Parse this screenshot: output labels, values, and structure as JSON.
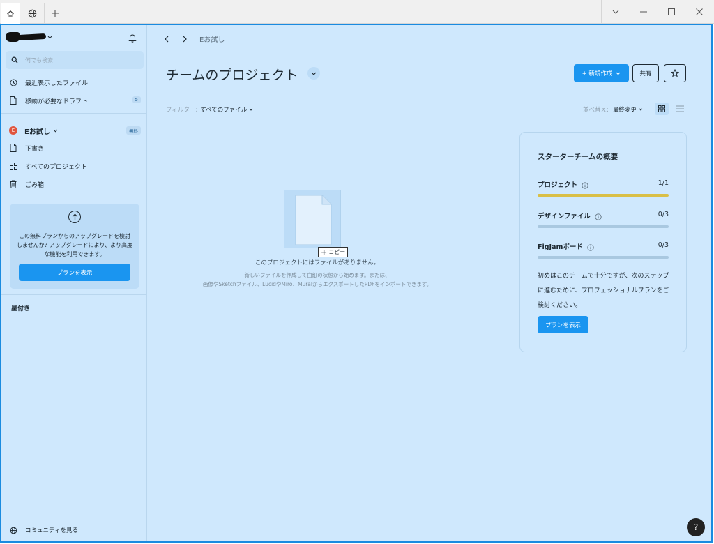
{
  "window": {
    "tabs": [
      {
        "icon": "home-icon"
      },
      {
        "icon": "globe-icon"
      }
    ],
    "new_tab_icon": "plus-icon",
    "controls": [
      "chevron-down-icon",
      "minimize-icon",
      "maximize-icon",
      "close-icon"
    ]
  },
  "sidebar": {
    "search_placeholder": "何でも検索",
    "items": [
      {
        "label": "最近表示したファイル",
        "icon": "clock-icon"
      },
      {
        "label": "移動が必要なドラフト",
        "icon": "file-icon",
        "badge": "5"
      }
    ],
    "team": {
      "initial": "E",
      "name": "Eお試し",
      "badge": "無料"
    },
    "team_items": [
      {
        "label": "下書き",
        "icon": "file-icon"
      },
      {
        "label": "すべてのプロジェクト",
        "icon": "grid-icon"
      },
      {
        "label": "ごみ箱",
        "icon": "trash-icon"
      }
    ],
    "upgrade": {
      "text": "この無料プランからのアップグレードを検討しませんか? アップグレードにより、より高度な機能を利用できます。",
      "button": "プランを表示"
    },
    "starred_heading": "星付き",
    "community": "コミュニティを見る"
  },
  "main": {
    "breadcrumb": "Eお試し",
    "title": "チームのプロジェクト",
    "new_button": "+ 新規作成",
    "share_button": "共有",
    "filter_label": "フィルター:",
    "filter_value": "すべてのファイル",
    "sort_label": "並べ替え:",
    "sort_value": "最終変更",
    "copy_tag": "コピー",
    "empty_title": "このプロジェクトにはファイルがありません。",
    "empty_line1": "新しいファイルを作成して白紙の状態から始めます。または、",
    "empty_line2": "画像やSketchファイル、LucidやMiro、MuralからエクスポートしたPDFをインポートできます。"
  },
  "overview": {
    "title": "スターターチームの概要",
    "rows": [
      {
        "label": "プロジェクト",
        "value": "1/1",
        "progress": 1.0
      },
      {
        "label": "デザインファイル",
        "value": "0/3",
        "progress": 0.0
      },
      {
        "label": "FigJamボード",
        "value": "0/3",
        "progress": 0.0
      }
    ],
    "description": "初めはこのチームで十分ですが、次のステップに進むために、プロフェッショナルプランをご検討ください。",
    "button": "プランを表示"
  },
  "help": "?",
  "colors": {
    "accent": "#1a95f0",
    "background": "#cfe8fd",
    "progress_fill": "#d9bf47",
    "frame_border": "#1a8be0"
  }
}
